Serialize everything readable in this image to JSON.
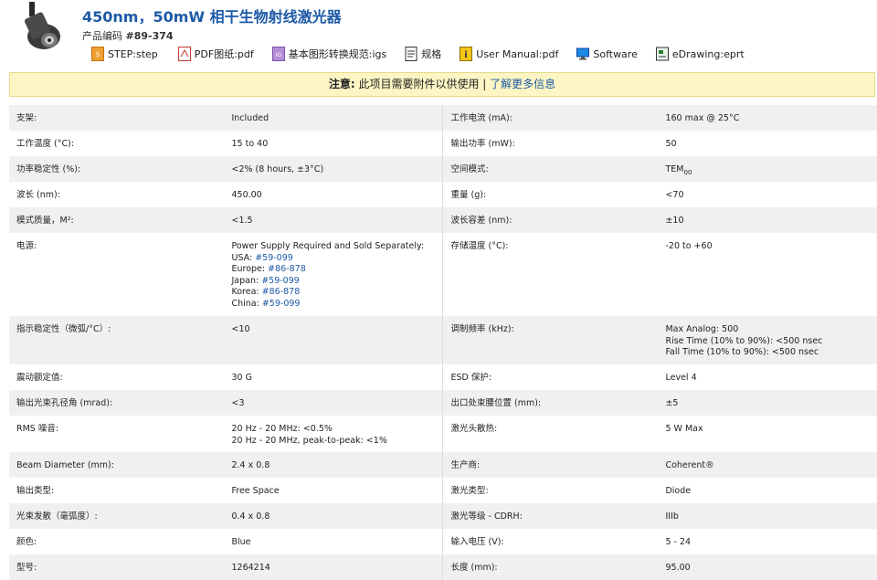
{
  "header": {
    "title": "450nm，50mW 相干生物射线激光器",
    "code_label": "产品编码",
    "code_value": "#89-374"
  },
  "files": [
    {
      "label": "STEP:step",
      "icon": "step-file-icon"
    },
    {
      "label": "PDF图纸:pdf",
      "icon": "pdf-file-icon"
    },
    {
      "label": "基本图形转换规范:igs",
      "icon": "igs-file-icon"
    },
    {
      "label": "规格",
      "icon": "document-icon"
    },
    {
      "label": "User Manual:pdf",
      "icon": "manual-file-icon"
    },
    {
      "label": "Software",
      "icon": "software-monitor-icon"
    },
    {
      "label": "eDrawing:eprt",
      "icon": "edrawing-file-icon"
    }
  ],
  "notice": {
    "prefix": "注意:",
    "text": " 此项目需要附件以供使用 | ",
    "link": "了解更多信息"
  },
  "specs": [
    {
      "l1": "支架:",
      "v1": [
        "Included"
      ],
      "l2": "工作电流 (mA):",
      "v2": [
        "160 max @ 25°C"
      ],
      "shade": true
    },
    {
      "l1": "工作温度 (°C):",
      "v1": [
        "15 to 40"
      ],
      "l2": "输出功率 (mW):",
      "v2": [
        "50"
      ],
      "shade": false
    },
    {
      "l1": "功率稳定性 (%):",
      "v1": [
        "<2% (8 hours, ±3°C)"
      ],
      "l2": "空间模式:",
      "v2": [
        "TEM00"
      ],
      "shade": true
    },
    {
      "l1": "波长 (nm):",
      "v1": [
        "450.00"
      ],
      "l2": "重量 (g):",
      "v2": [
        "<70"
      ],
      "shade": false
    },
    {
      "l1": "模式质量，M²:",
      "v1": [
        "<1.5"
      ],
      "l2": "波长容差 (nm):",
      "v2": [
        "±10"
      ],
      "shade": true
    },
    {
      "l1": "电源:",
      "v1": [
        "Power Supply Required and Sold Separately:",
        "USA: #59-099",
        "Europe: #86-878",
        "Japan: #59-099",
        "Korea: #86-878",
        "China: #59-099"
      ],
      "l2": "存储温度 (°C):",
      "v2": [
        "-20 to +60"
      ],
      "shade": false
    },
    {
      "l1": "指示稳定性（微弧/°C）:",
      "v1": [
        "<10"
      ],
      "l2": "调制频率 (kHz):",
      "v2": [
        "Max Analog: 500",
        "Rise Time (10% to 90%): <500 nsec",
        "Fall Time (10% to 90%): <500 nsec"
      ],
      "shade": true
    },
    {
      "l1": "震动额定值:",
      "v1": [
        "30 G"
      ],
      "l2": "ESD 保护:",
      "v2": [
        "Level 4"
      ],
      "shade": false
    },
    {
      "l1": "输出光束孔径角 (mrad):",
      "v1": [
        "<3"
      ],
      "l2": "出口处束腰位置 (mm):",
      "v2": [
        "±5"
      ],
      "shade": true
    },
    {
      "l1": "RMS 噪音:",
      "v1": [
        "20 Hz - 20 MHz: <0.5%",
        "20 Hz - 20 MHz, peak-to-peak: <1%"
      ],
      "l2": "激光头散热:",
      "v2": [
        "5 W Max"
      ],
      "shade": false
    },
    {
      "l1": "Beam Diameter (mm):",
      "v1": [
        "2.4 x 0.8"
      ],
      "l2": "生产商:",
      "v2": [
        "Coherent®"
      ],
      "shade": true
    },
    {
      "l1": "输出类型:",
      "v1": [
        "Free Space"
      ],
      "l2": "激光类型:",
      "v2": [
        "Diode"
      ],
      "shade": false
    },
    {
      "l1": "光束发散（毫弧度）:",
      "v1": [
        "0.4 x 0.8"
      ],
      "l2": "激光等级 - CDRH:",
      "v2": [
        "IIIb"
      ],
      "shade": true
    },
    {
      "l1": "颜色:",
      "v1": [
        "Blue"
      ],
      "l2": "输入电压 (V):",
      "v2": [
        "5 - 24"
      ],
      "shade": false
    },
    {
      "l1": "型号:",
      "v1": [
        "1264214"
      ],
      "l2": "长度 (mm):",
      "v2": [
        "95.00"
      ],
      "shade": true
    }
  ],
  "colors": {
    "title": "#1d5aa6",
    "link": "#1d5aa6",
    "notice_bg": "#fdf6c4",
    "shade": "#f0f0f0"
  }
}
